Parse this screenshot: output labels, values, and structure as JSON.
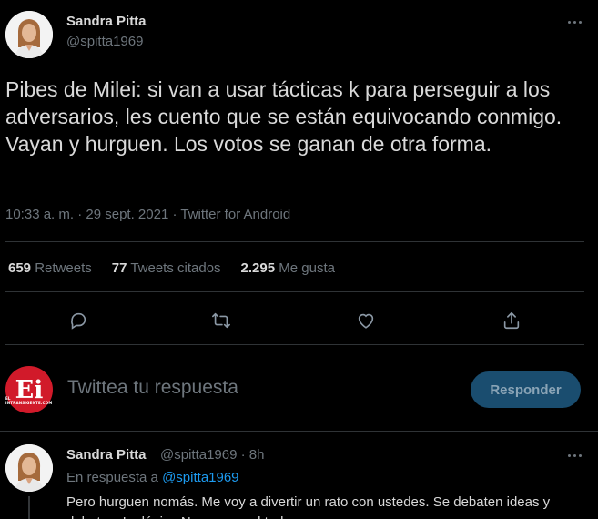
{
  "tweet": {
    "author_name": "Sandra Pitta",
    "author_handle": "@spitta1969",
    "text": "Pibes de Milei: si van a usar tácticas k para perseguir a los adversarios, les cuento que se están equivocando conmigo. Vayan y hurguen. Los votos se ganan de otra forma.",
    "meta": "10:33 a. m. · 29 sept. 2021 · Twitter for Android",
    "stats": [
      {
        "value": "659",
        "label": "Retweets"
      },
      {
        "value": "77",
        "label": "Tweets citados"
      },
      {
        "value": "2.295",
        "label": "Me gusta"
      }
    ],
    "actions": [
      "reply-icon",
      "retweet-icon",
      "like-icon",
      "share-icon"
    ]
  },
  "composer": {
    "logo_text": "Ei",
    "logo_subtext": "EL INTRANSIGENTE.COM",
    "placeholder": "Twittea tu respuesta",
    "button_label": "Responder"
  },
  "reply": {
    "author_name": "Sandra Pitta",
    "author_handle_time": "@spitta1969 · 8h",
    "in_reply_prefix": "En respuesta a",
    "in_reply_handle": "@spitta1969",
    "text": "Pero hurguen nomás. Me voy a divertir un rato con ustedes. Se debaten ideas y debates. La lógica Nunca usa el troleo"
  },
  "colors": {
    "background": "#000000",
    "text": "#d9d9d9",
    "muted": "#6e767d",
    "accent": "#1d9bf0",
    "button_disabled": "#1a4d6f"
  }
}
